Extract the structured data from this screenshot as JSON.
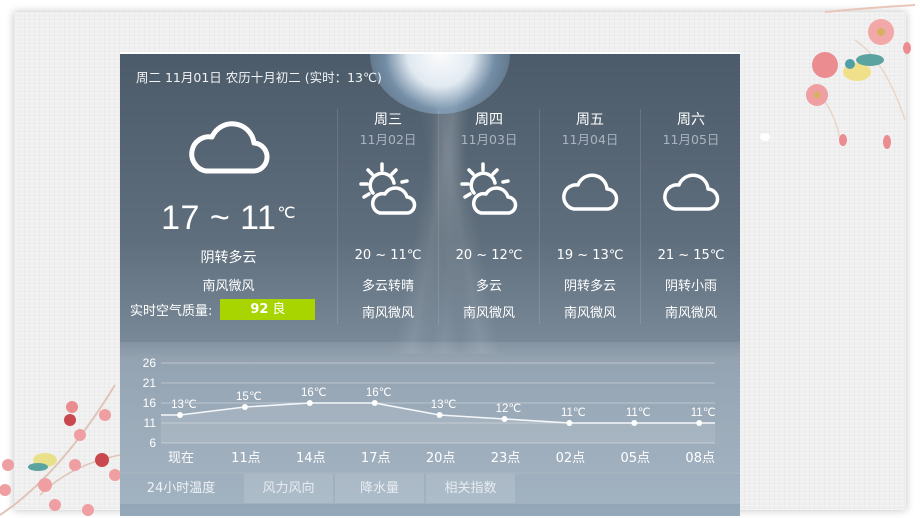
{
  "header": {
    "date_line": "周二 11月01日 农历十月初二 (实时：13℃)"
  },
  "today": {
    "icon": "cloud-icon",
    "temp_range": "17 ~ 11",
    "temp_unit": "℃",
    "condition": "阴转多云",
    "wind": "南风微风",
    "aqi_label": "实时空气质量:",
    "aqi_value": "92",
    "aqi_level": "良",
    "aqi_color": "#a8d400"
  },
  "forecast": [
    {
      "weekday": "周三",
      "date": "11月02日",
      "icon": "partly-sunny-icon",
      "temp": "20 ~ 11℃",
      "condition": "多云转晴",
      "wind": "南风微风"
    },
    {
      "weekday": "周四",
      "date": "11月03日",
      "icon": "partly-sunny-icon",
      "temp": "20 ~ 12℃",
      "condition": "多云",
      "wind": "南风微风"
    },
    {
      "weekday": "周五",
      "date": "11月04日",
      "icon": "cloud-icon",
      "temp": "19 ~ 13℃",
      "condition": "阴转多云",
      "wind": "南风微风"
    },
    {
      "weekday": "周六",
      "date": "11月05日",
      "icon": "cloud-icon",
      "temp": "21 ~ 15℃",
      "condition": "阴转小雨",
      "wind": "南风微风"
    }
  ],
  "chart_data": {
    "type": "line",
    "title": "24小时温度",
    "categories": [
      "现在",
      "11点",
      "14点",
      "17点",
      "20点",
      "23点",
      "02点",
      "05点",
      "08点"
    ],
    "series": [
      {
        "name": "温度",
        "values": [
          13,
          15,
          16,
          16,
          13,
          12,
          11,
          11,
          11
        ]
      }
    ],
    "data_labels": [
      "13℃",
      "15℃",
      "16℃",
      "16℃",
      "13℃",
      "12℃",
      "11℃",
      "11℃",
      "11℃"
    ],
    "yticks": [
      26,
      21,
      16,
      11,
      6
    ],
    "ylim": [
      6,
      26
    ],
    "grid": true,
    "xlabel": "",
    "ylabel": ""
  },
  "tabs": [
    {
      "label": "24小时温度",
      "active": true
    },
    {
      "label": "风力风向",
      "active": false
    },
    {
      "label": "降水量",
      "active": false
    },
    {
      "label": "相关指数",
      "active": false
    }
  ]
}
